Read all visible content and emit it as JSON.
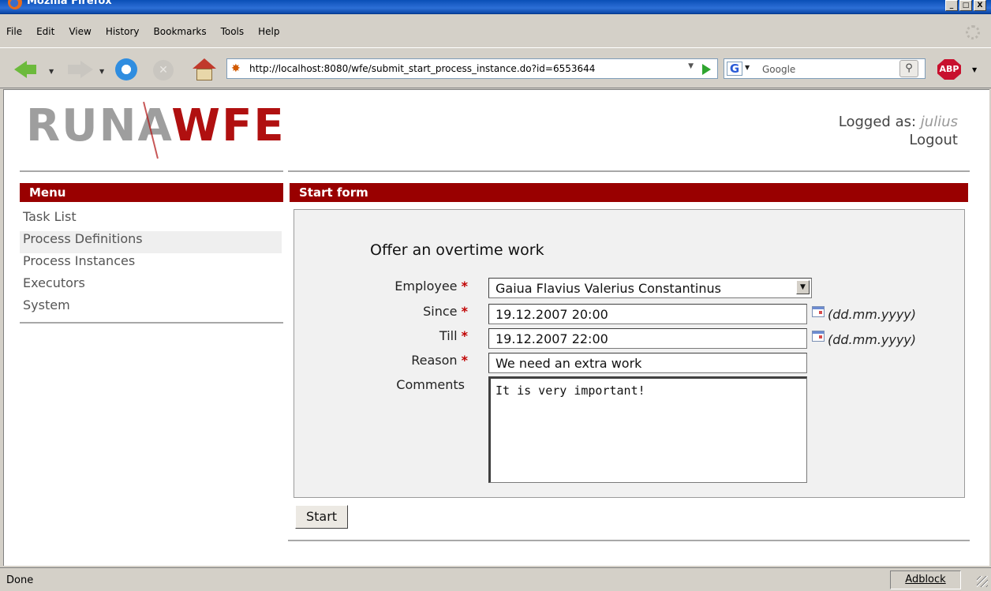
{
  "window": {
    "title": "Mozilla Firefox",
    "controls": [
      "_",
      "□",
      "X"
    ]
  },
  "menubar": [
    "File",
    "Edit",
    "View",
    "History",
    "Bookmarks",
    "Tools",
    "Help"
  ],
  "navbar": {
    "url": "http://localhost:8080/wfe/submit_start_process_instance.do?id=6553644",
    "search_engine_icon": "G",
    "search_placeholder": "Google",
    "adblock_icon": "ABP"
  },
  "page": {
    "logo_part1": "RUNA",
    "logo_part2": "WFE",
    "logged_as_label": "Logged as:",
    "username": "julius",
    "logout_label": "Logout",
    "menu_title": "Menu",
    "menu_items": [
      {
        "label": "Task List"
      },
      {
        "label": "Process Definitions"
      },
      {
        "label": "Process Instances"
      },
      {
        "label": "Executors"
      },
      {
        "label": "System"
      }
    ],
    "section_title": "Start form",
    "form": {
      "title": "Offer an overtime work",
      "required_mark": "*",
      "employee_label": "Employee",
      "employee_value": "Gaiua Flavius Valerius Constantinus",
      "since_label": "Since",
      "since_value": "19.12.2007 20:00",
      "till_label": "Till",
      "till_value": "19.12.2007 22:00",
      "date_hint": "(dd.mm.yyyy)",
      "reason_label": "Reason",
      "reason_value": "We need an extra work",
      "comments_label": "Comments",
      "comments_value": "It is very important!",
      "submit_label": "Start"
    }
  },
  "statusbar": {
    "status": "Done",
    "adblock": "Adblock"
  },
  "colors": {
    "header_red": "#990000",
    "logo_red": "#b01010",
    "logo_gray": "#9e9e9e",
    "required_red": "#c00000"
  }
}
